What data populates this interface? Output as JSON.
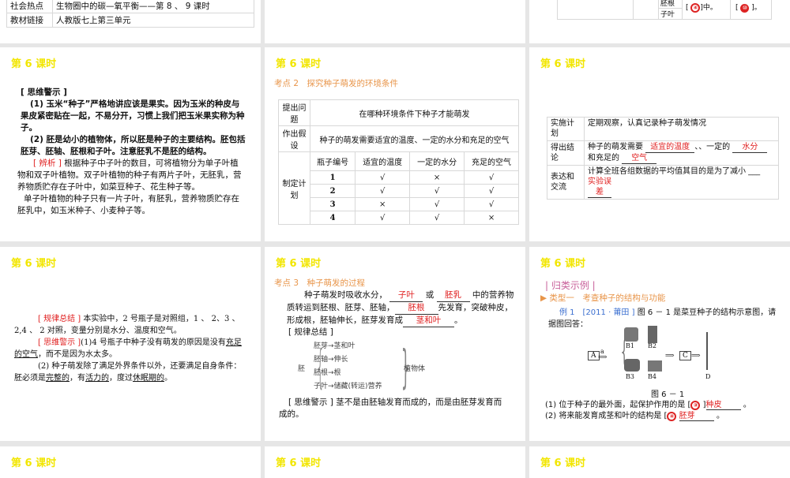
{
  "slide_title": "第 6 课时",
  "top_left_table": [
    [
      "社会热点",
      "生物圈中的碳—氧平衡——第 8 、 9 课时"
    ],
    [
      "教材链接",
      "人教版七上第三单元"
    ]
  ],
  "top_right_table": {
    "cells": [
      "胚根",
      "子叶"
    ],
    "answer1_pre": "[",
    "answer1_num": "④",
    "answer1_post": "]中。",
    "answer2_pre": "[",
    "answer2_num": "⑩",
    "answer2_post": "]。"
  },
  "s1": {
    "warn_label": "[ 思维警示 ]",
    "warn1": "(1) 玉米“种子”严格地讲应该是果实。因为玉米的种皮与果皮紧密贴在一起，不易分开，习惯上我们把玉米果实称为种子。",
    "warn2": "(2) 胚是幼小的植物体，所以胚是种子的主要结构。胚包括胚芽、胚轴、胚根和子叶。注意胚乳不是胚的结构。",
    "analysis_label": "[ 辨析 ]",
    "analysis1": " 根据种子中子叶的数目，可将植物分为单子叶植物和双子叶植物。双子叶植物的种子有两片子叶，无胚乳，营养物质贮存在子叶中，如菜豆种子、花生种子等。",
    "analysis2": "单子叶植物的种子只有一片子叶，有胚乳，营养物质贮存在胚乳中，如玉米种子、小麦种子等。"
  },
  "s2": {
    "heading": "考点 2　探究种子萌发的环境条件",
    "q_label": "提出问题",
    "q": "在哪种环境条件下种子才能萌发",
    "h_label": "作出假设",
    "h": "种子的萌发需要适宜的温度、一定的水分和充足的空气",
    "plan_label": "制定计划",
    "headers": [
      "瓶子编号",
      "适宜的温度",
      "一定的水分",
      "充足的空气"
    ],
    "rows": [
      [
        "1",
        "√",
        "×",
        "√"
      ],
      [
        "2",
        "√",
        "√",
        "√"
      ],
      [
        "3",
        "×",
        "√",
        "√"
      ],
      [
        "4",
        "√",
        "√",
        "×"
      ]
    ]
  },
  "s3": {
    "impl_label": "实施计划",
    "impl": "定期观察，认真记录种子萌发情况",
    "concl_label": "得出结论",
    "concl_a": "种子的萌发需要",
    "ans1": "适宜的温度",
    "concl_b": "、一定的",
    "ans2": "水分",
    "concl_c": "和充足的",
    "ans3": "空气",
    "expr_label": "表达和交流",
    "expr": "计算全班各组数据的平均值其目的是为了减小",
    "ans4": "实验误差"
  },
  "s4": {
    "rule_label": "[ 规律总结 ]",
    "rule": " 本实验中，2 号瓶子是对照组，1 、 2、3 、2,4 、 2 对照，变量分别是水分、温度和空气。",
    "warn_label": "[ 思维警示 ]",
    "warn1a": "(1)4 号瓶子中种子没有萌发的原因是没有",
    "warn1u": "充足的空气",
    "warn1b": "，而不是因为水太多。",
    "warn2a": "(2) 种子萌发除了满足外界条件以外，还要满足自身条件：胚必须是",
    "u1": "完整的",
    "warn2b": "，有",
    "u2": "活力的",
    "warn2c": "，度过",
    "u3": "休眠期的",
    "warn2d": "。"
  },
  "s5": {
    "heading": "考点 3　种子萌发的过程",
    "t1": "种子萌发时吸收水分，",
    "a1": "子叶",
    "t2": "或",
    "a2": "胚乳",
    "t3": "中的营养物质转运到胚根、胚芽、胚轴，",
    "a3": "胚根",
    "t4": "先发育，突破种皮，形成根，胚轴伸长，胚芽发育成",
    "a4": "茎和叶",
    "t5": "。",
    "rule_label": "[ 规律总结 ]",
    "root": "胚",
    "branches": [
      "胚芽→茎和叶",
      "胚轴→伸长",
      "胚根→根",
      "子叶→储藏(转运)营养"
    ],
    "result": "植物体",
    "warn_label": "[ 思维警示 ]",
    "warn": " 茎不是由胚轴发育而成的，而是由胚芽发育而成的。"
  },
  "s6": {
    "section": "| 归类示例 |",
    "type": "▶ 类型一　考查种子的结构与功能",
    "ex_label": "例 1　[2011 · 莆田 ]",
    "ex": " 图 6 － 1 是菜豆种子的结构示意图，请据图回答：",
    "fig_labels": [
      "A",
      "a",
      "B1",
      "B2",
      "B3",
      "B4",
      "C",
      "D"
    ],
    "caption": "图 6 － 1",
    "q1": "(1) 位于种子的最外面，起保护作用的是 [",
    "q1n": "③",
    "q1a": "种皮",
    "q2": "(2) 将来能发育成茎和叶的结构是 [",
    "q2n": "④",
    "q2a": "胚芽",
    "end": "。"
  }
}
